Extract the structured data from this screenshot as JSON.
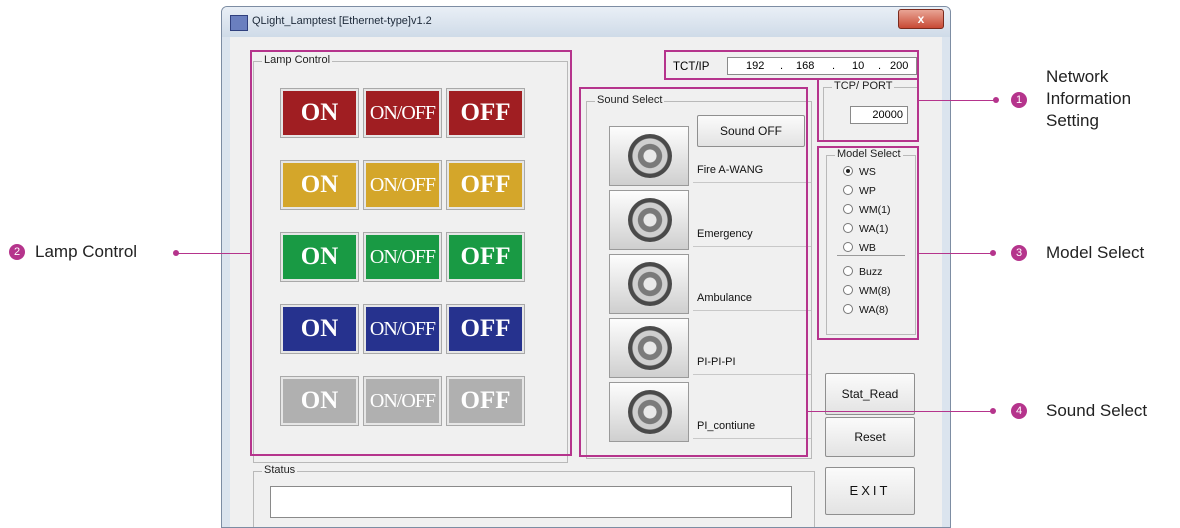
{
  "window": {
    "title": "QLight_Lamptest [Ethernet-type]v1.2",
    "close_label": "x"
  },
  "lamp_control": {
    "label": "Lamp Control",
    "rows": [
      {
        "color": "#a01e22",
        "on": "ON",
        "onoff": "ON/OFF",
        "off": "OFF"
      },
      {
        "color": "#d4a62a",
        "on": "ON",
        "onoff": "ON/OFF",
        "off": "OFF"
      },
      {
        "color": "#199a44",
        "on": "ON",
        "onoff": "ON/OFF",
        "off": "OFF"
      },
      {
        "color": "#26328e",
        "on": "ON",
        "onoff": "ON/OFF",
        "off": "OFF"
      },
      {
        "color": "#b0b0b0",
        "on": "ON",
        "onoff": "ON/OFF",
        "off": "OFF"
      }
    ]
  },
  "network": {
    "ip_label": "TCT/IP",
    "ip": [
      "192",
      "168",
      "10",
      "200"
    ],
    "port_group_label": "TCP/ PORT",
    "port": "20000"
  },
  "sound_select": {
    "label": "Sound Select",
    "sound_off_label": "Sound OFF",
    "sounds": [
      "Fire A-WANG",
      "Emergency",
      "Ambulance",
      "PI-PI-PI",
      "PI_contiune"
    ]
  },
  "model_select": {
    "label": "Model Select",
    "options_top": [
      "WS",
      "WP",
      "WM(1)",
      "WA(1)",
      "WB"
    ],
    "options_bottom": [
      "Buzz",
      "WM(8)",
      "WA(8)"
    ],
    "selected": "WS"
  },
  "buttons": {
    "stat_read": "Stat_Read",
    "reset": "Reset",
    "exit": "EXIT"
  },
  "status": {
    "label": "Status",
    "value": ""
  },
  "annotations": {
    "network": {
      "num": "1",
      "text": "Network\nInformation\nSetting"
    },
    "lamp": {
      "num": "2",
      "text": "Lamp Control"
    },
    "model": {
      "num": "3",
      "text": "Model Select"
    },
    "sound": {
      "num": "4",
      "text": "Sound Select"
    }
  },
  "accent_color": "#b5348c"
}
